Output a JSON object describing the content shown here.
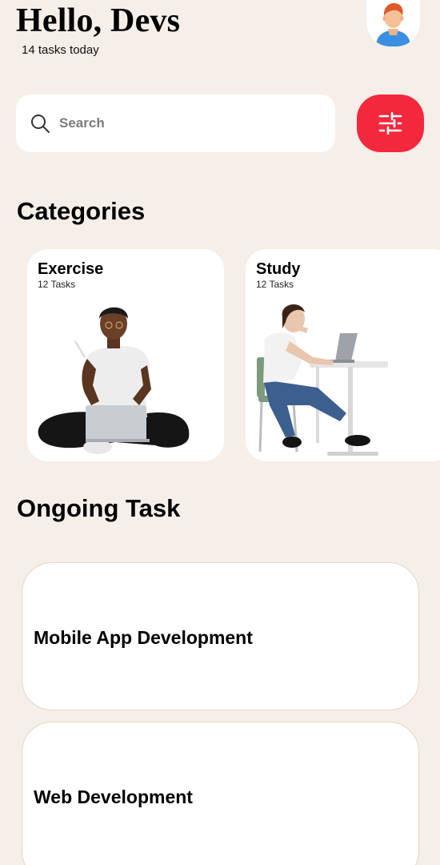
{
  "header": {
    "greeting": "Hello, Devs",
    "subtitle": "14 tasks today",
    "avatar_icon": "user-avatar-icon"
  },
  "search": {
    "placeholder": "Search",
    "icon": "search-icon"
  },
  "filter_button": {
    "icon": "sliders-icon",
    "color": "#f4283d"
  },
  "categories": {
    "title": "Categories",
    "items": [
      {
        "name": "Exercise",
        "count": "12 Tasks"
      },
      {
        "name": "Study",
        "count": "12 Tasks"
      }
    ]
  },
  "ongoing": {
    "title": "Ongoing Task",
    "items": [
      {
        "title": "Mobile App Development"
      },
      {
        "title": "Web Development"
      }
    ]
  },
  "colors": {
    "background": "#f6eee8",
    "card": "#ffffff",
    "accent": "#f4283d",
    "task_border": "#e6d5c0"
  }
}
